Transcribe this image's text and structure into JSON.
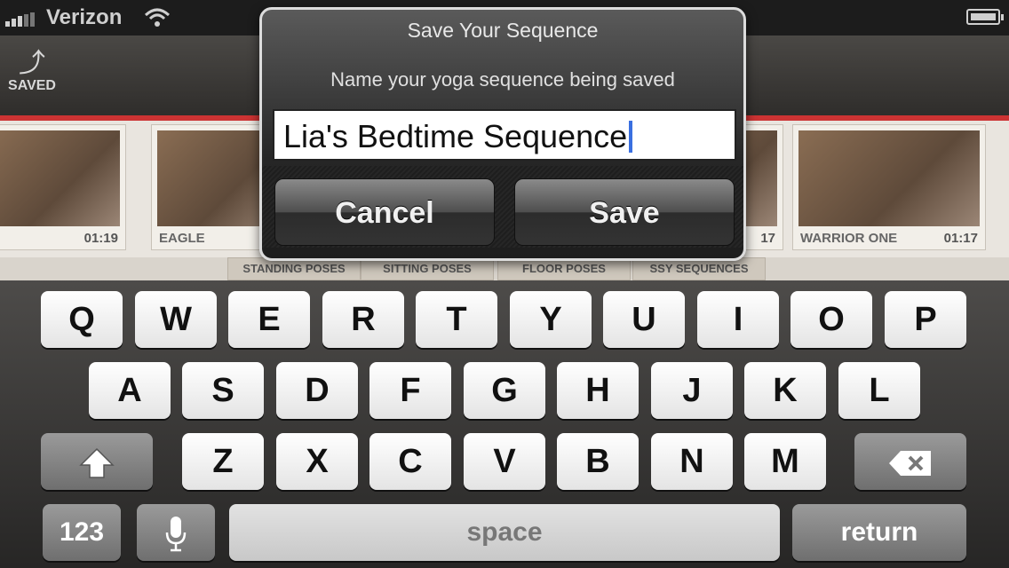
{
  "status_bar": {
    "carrier": "Verizon",
    "signal_icon": "signal-bars-icon",
    "wifi_icon": "wifi-icon",
    "battery_icon": "battery-icon"
  },
  "toolbar": {
    "saved_label": "SAVED",
    "saved_icon": "save-return-icon"
  },
  "pose_cards": [
    {
      "name": "",
      "duration": "01:19"
    },
    {
      "name": "EAGLE",
      "duration": ""
    },
    {
      "name": "",
      "duration": "17"
    },
    {
      "name": "WARRIOR ONE",
      "duration": "01:17"
    }
  ],
  "tabs": [
    "STANDING POSES",
    "SITTING POSES",
    "FLOOR POSES",
    "SSY SEQUENCES"
  ],
  "dialog": {
    "title": "Save Your Sequence",
    "message": "Name your yoga sequence being saved",
    "input_value": "Lia's Bedtime Sequence",
    "cancel_label": "Cancel",
    "save_label": "Save"
  },
  "keyboard": {
    "row1": [
      "Q",
      "W",
      "E",
      "R",
      "T",
      "Y",
      "U",
      "I",
      "O",
      "P"
    ],
    "row2": [
      "A",
      "S",
      "D",
      "F",
      "G",
      "H",
      "J",
      "K",
      "L"
    ],
    "row3": [
      "Z",
      "X",
      "C",
      "V",
      "B",
      "N",
      "M"
    ],
    "numbers_label": "123",
    "space_label": "space",
    "return_label": "return",
    "shift_icon": "shift-icon",
    "delete_icon": "backspace-icon",
    "mic_icon": "microphone-icon"
  },
  "colors": {
    "accent_red": "#cc3333",
    "caret": "#3a6fe0"
  }
}
